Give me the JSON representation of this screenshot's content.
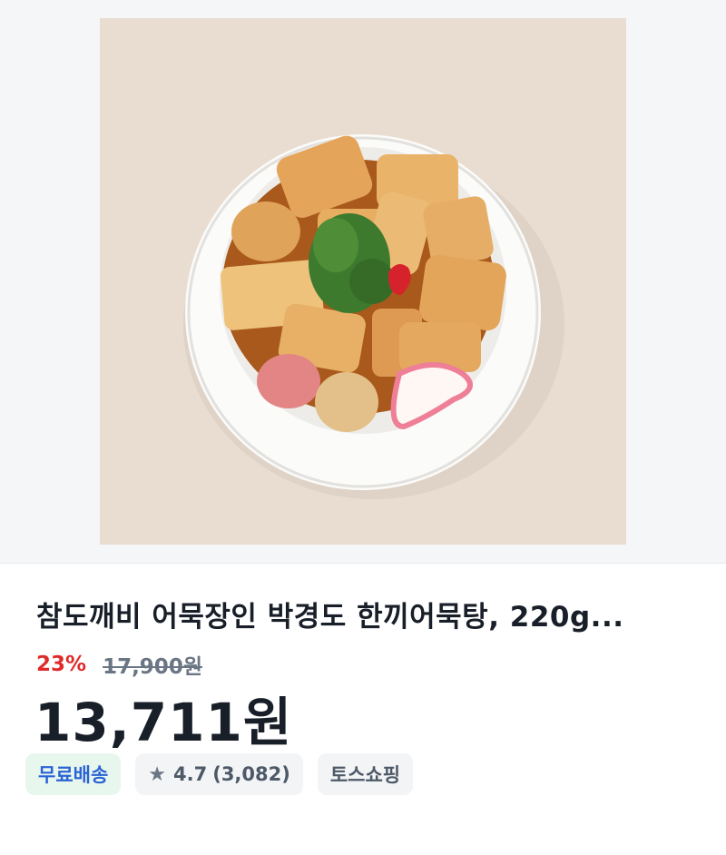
{
  "product": {
    "title": "참도깨비 어묵장인 박경도 한끼어묵탕, 220g...",
    "discount": "23%",
    "original_price": "17,900원",
    "price": "13,711원",
    "image_alt": "fish cake soup in white bowl"
  },
  "badges": {
    "shipping": "무료배송",
    "rating": "4.7",
    "review_count": "(3,082)",
    "seller": "토스쇼핑"
  },
  "icons": {
    "rating": "star-icon"
  },
  "colors": {
    "discount": "#e02a2a",
    "shipping_text": "#2a63d4",
    "shipping_bg": "#e8f7ee"
  }
}
